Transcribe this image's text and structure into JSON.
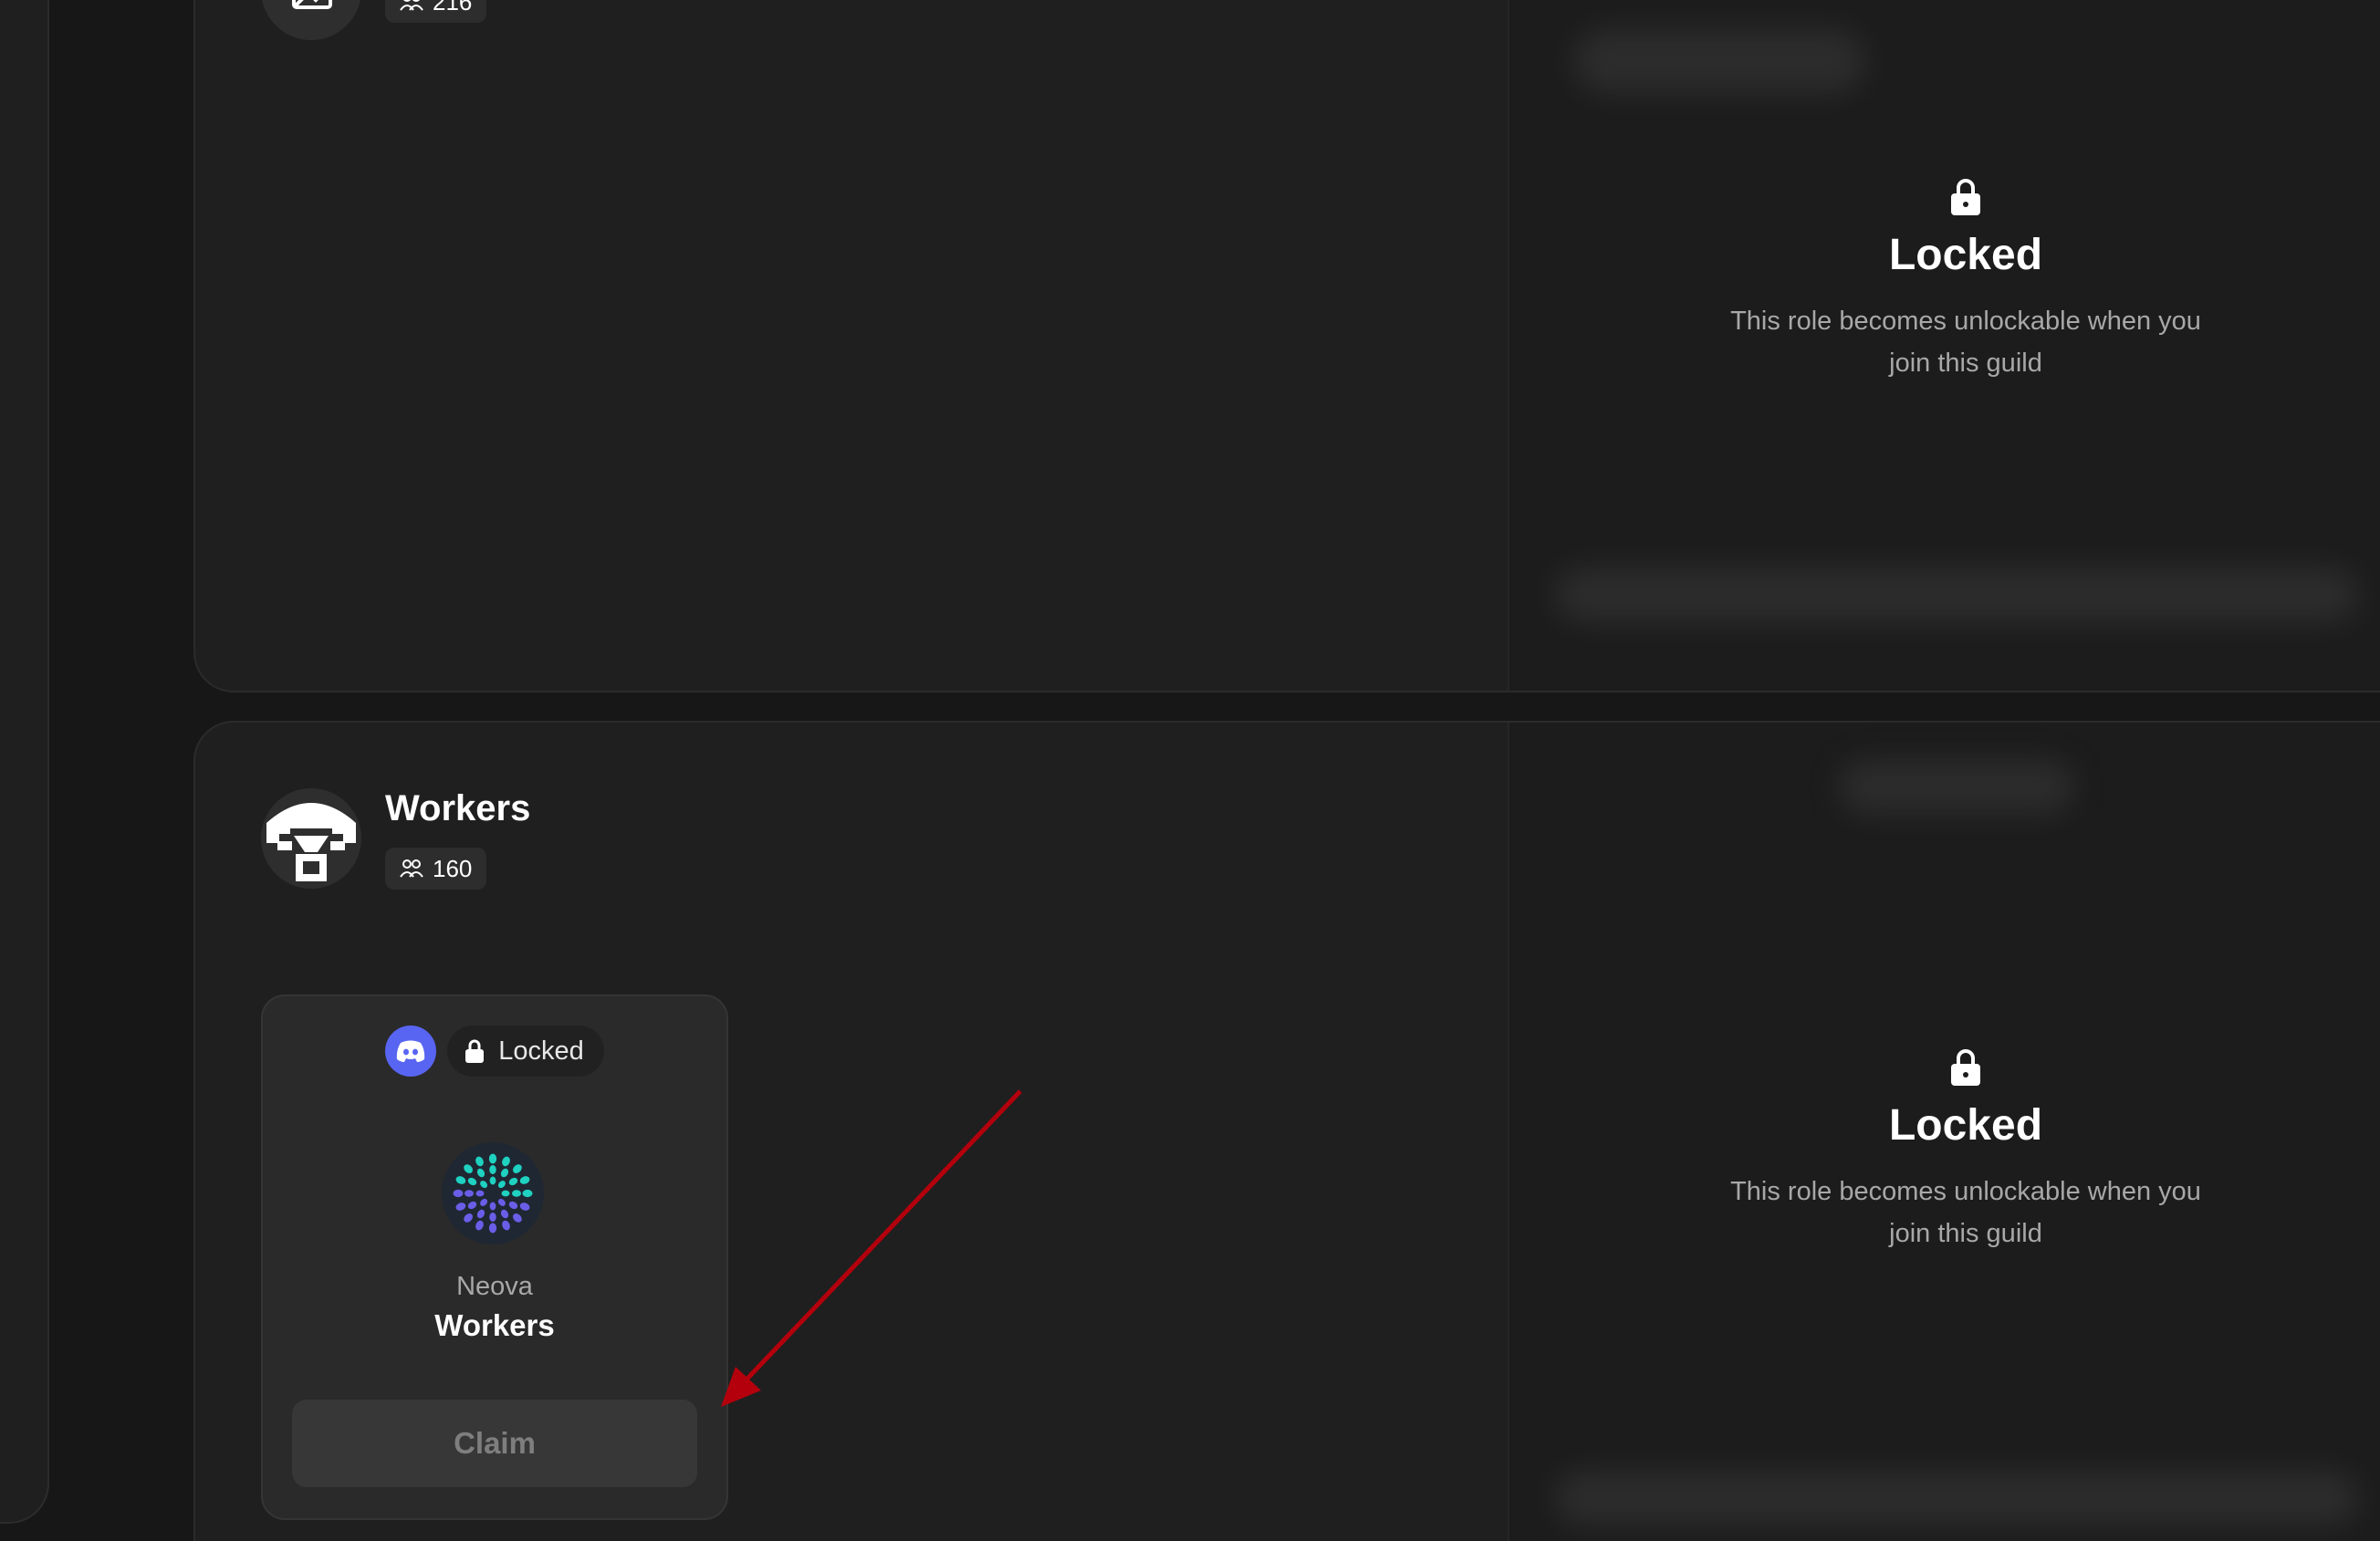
{
  "roles": [
    {
      "name": "",
      "member_count": "216",
      "lock_panel": {
        "title": "Locked",
        "description": "This role becomes unlockable when you join this guild"
      }
    },
    {
      "name": "Workers",
      "member_count": "160",
      "lock_panel": {
        "title": "Locked",
        "description": "This role becomes unlockable when you join this guild"
      },
      "reward": {
        "platform_icon": "discord-icon",
        "status": "Locked",
        "server_name": "Neova",
        "role_name": "Workers",
        "claim_label": "Claim"
      }
    }
  ],
  "colors": {
    "background": "#171717",
    "card": "#1f1f1f",
    "discord": "#5865f2",
    "annotation_arrow": "#b3000c"
  },
  "icons": {
    "lock": "lock-icon",
    "members": "users-icon",
    "avatar": "pixel-helmet-icon",
    "server_logo": "dotted-sunburst-icon"
  }
}
